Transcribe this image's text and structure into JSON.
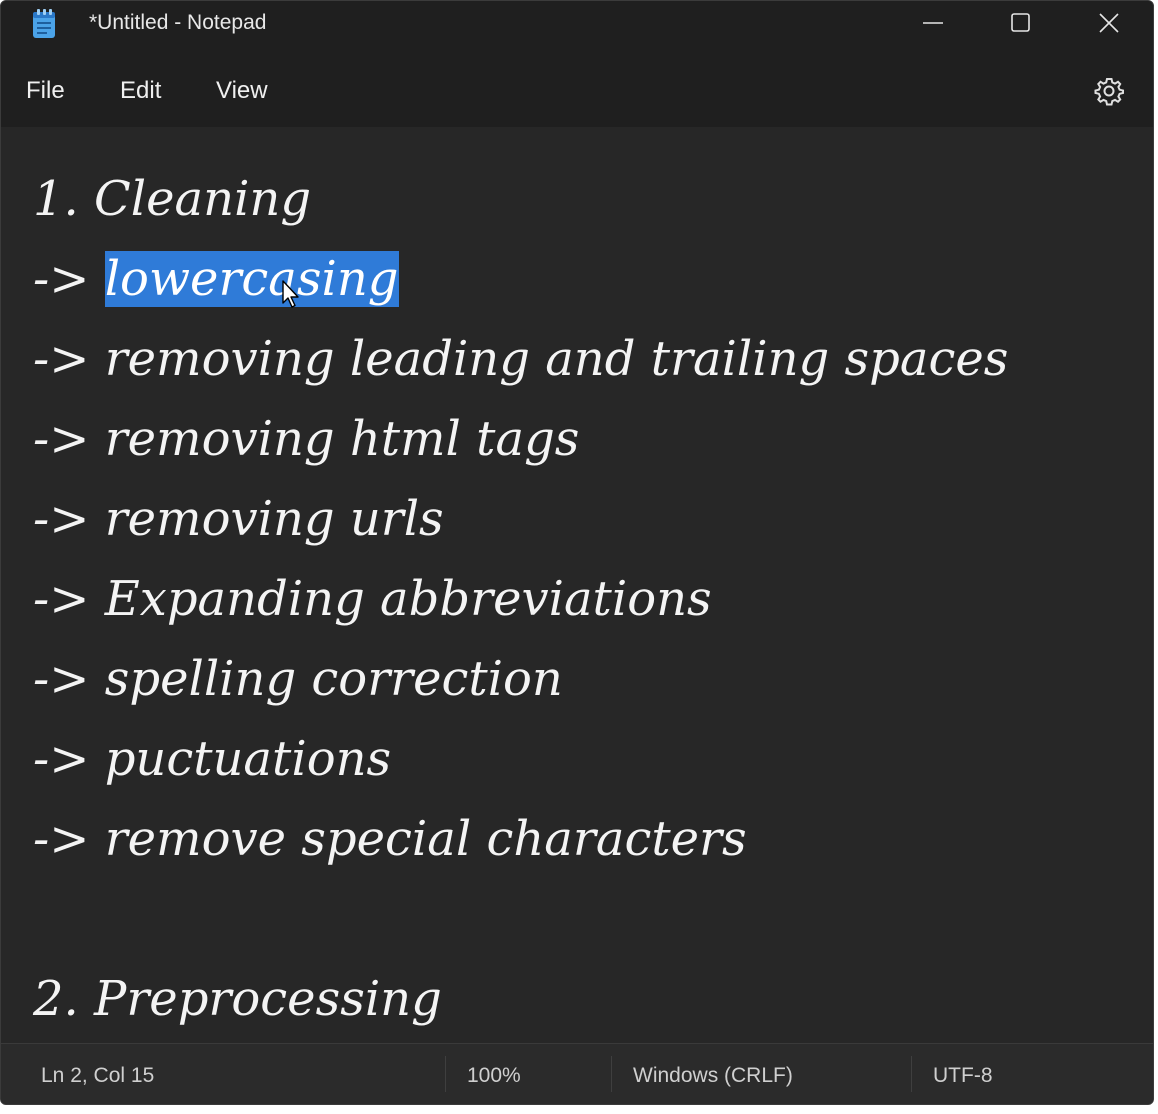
{
  "window": {
    "title": "*Untitled - Notepad"
  },
  "titlebar": {
    "icons": {
      "app": "notepad-app-icon",
      "minimize": "minimize-icon",
      "maximize": "maximize-icon",
      "close": "close-icon"
    }
  },
  "menu": {
    "items": [
      {
        "label": "File"
      },
      {
        "label": "Edit"
      },
      {
        "label": "View"
      }
    ],
    "settings_icon": "gear-icon"
  },
  "editor": {
    "lines": [
      {
        "prefix": "",
        "text": "1. Cleaning"
      },
      {
        "prefix": "-> ",
        "text": "lowercasing",
        "selected": true
      },
      {
        "prefix": "-> ",
        "text": "removing leading and trailing spaces"
      },
      {
        "prefix": "-> ",
        "text": "removing html tags"
      },
      {
        "prefix": "-> ",
        "text": "removing urls"
      },
      {
        "prefix": "-> ",
        "text": "Expanding abbreviations"
      },
      {
        "prefix": "-> ",
        "text": "spelling correction"
      },
      {
        "prefix": "-> ",
        "text": "puctuations"
      },
      {
        "prefix": "-> ",
        "text": "remove special characters"
      },
      {
        "prefix": "",
        "text": ""
      },
      {
        "prefix": "",
        "text": "2. Preprocessing"
      }
    ],
    "selection_color": "#2f7bd8",
    "background_color": "#272727",
    "text_color": "#f4f4f4"
  },
  "statusbar": {
    "position": "Ln 2, Col 15",
    "zoom": "100%",
    "line_ending": "Windows (CRLF)",
    "encoding": "UTF-8"
  }
}
